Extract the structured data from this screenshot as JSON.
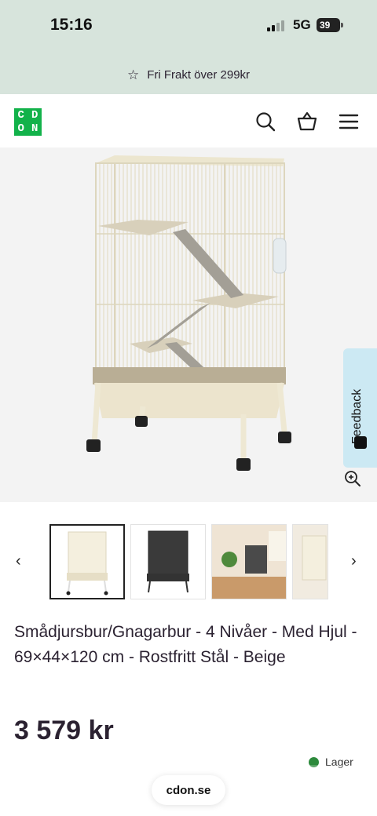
{
  "status": {
    "time": "15:16",
    "network": "5G",
    "battery": "39"
  },
  "promo": {
    "text": "Fri Frakt över 299kr",
    "icon": "star-icon"
  },
  "header": {
    "logo_letters": [
      "C",
      "D",
      "O",
      "N"
    ],
    "logo_color": "#12b24a",
    "icons": [
      "search-icon",
      "basket-icon",
      "menu-icon"
    ]
  },
  "feedback": {
    "label": "Feedback"
  },
  "gallery": {
    "thumb_count": 4,
    "active_index": 0
  },
  "product": {
    "title": "Smådjursbur/Gnagarbur - 4 Nivåer - Med Hjul - 69×44×120 cm - Rostfritt Stål - Beige",
    "price": "3 579 kr",
    "stock": "Lager"
  },
  "browser": {
    "url": "cdon.se"
  },
  "colors": {
    "promo_bg": "#d7e4dc",
    "feedback_bg": "#cce9f3",
    "stock_green": "#2d8a3c",
    "text": "#2b2231"
  }
}
